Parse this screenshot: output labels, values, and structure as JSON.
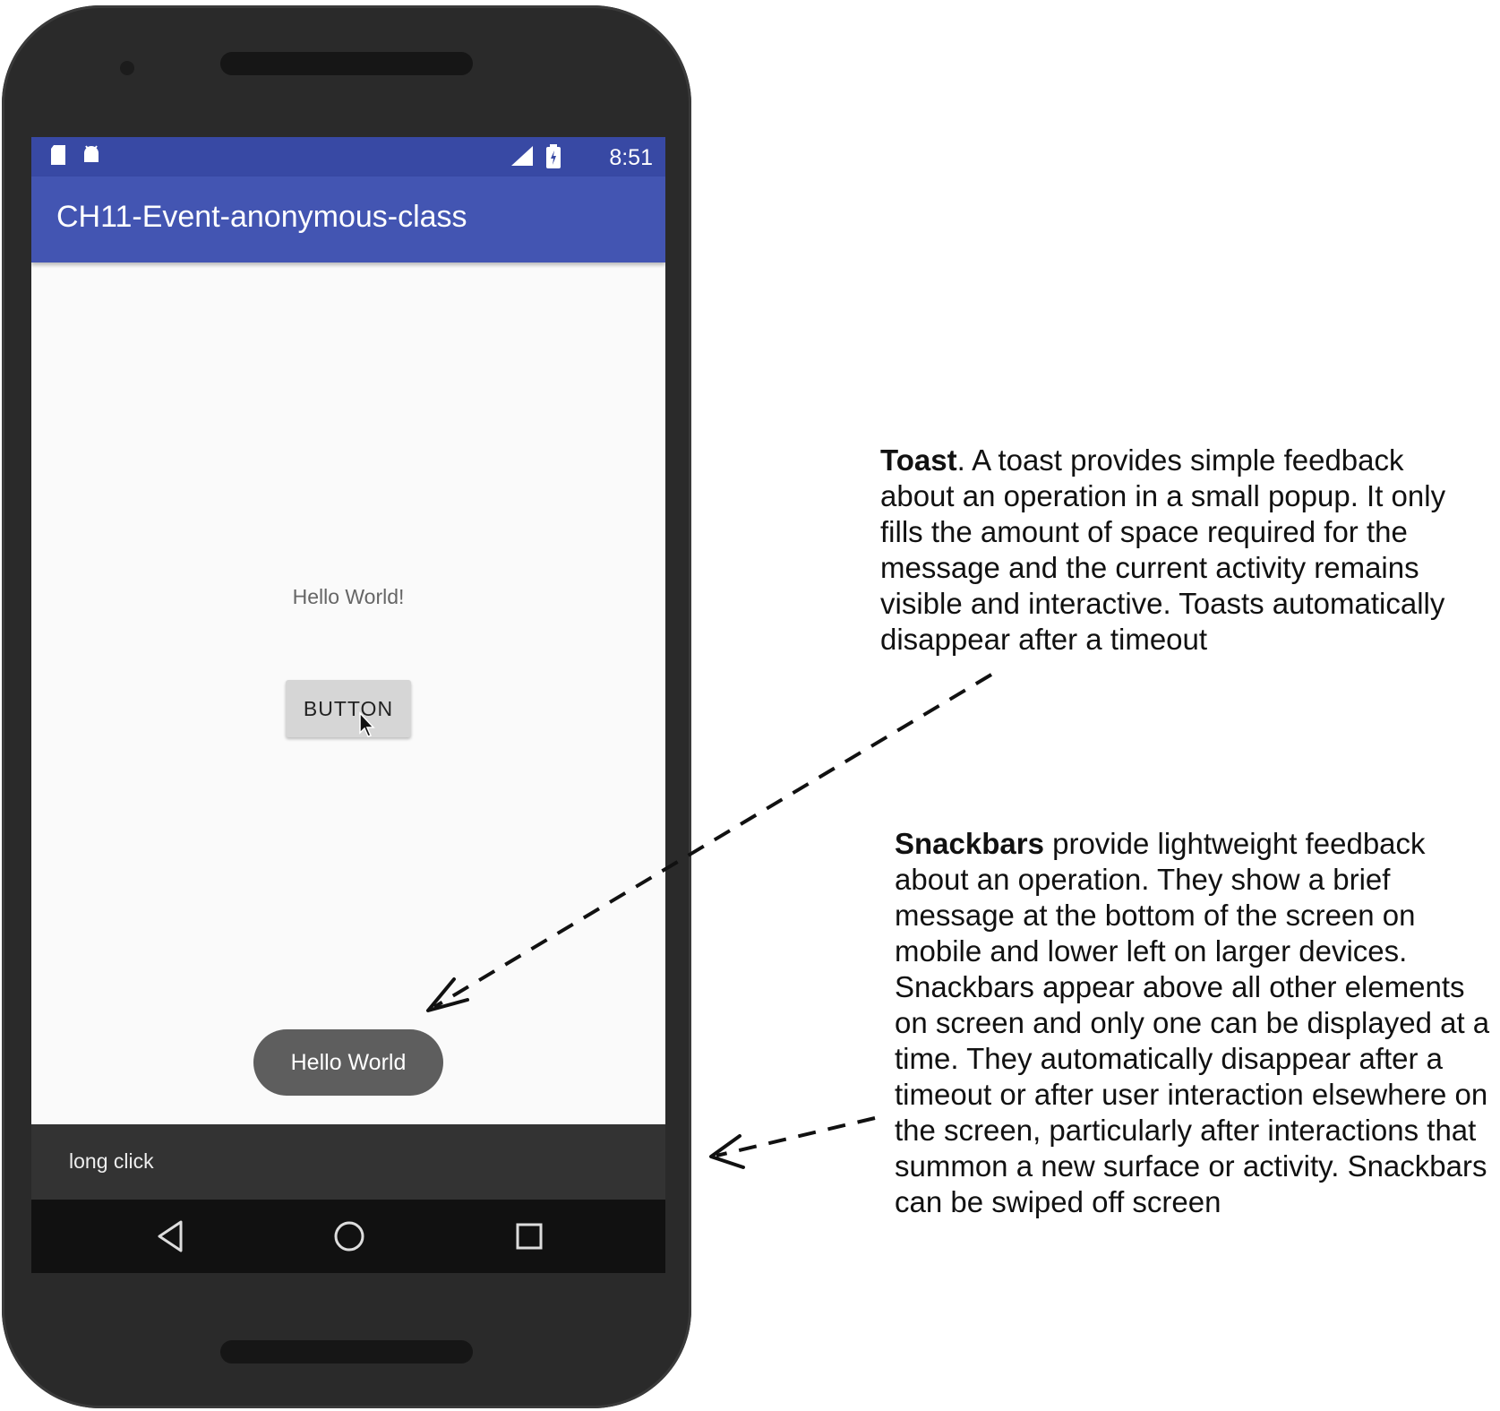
{
  "status_bar": {
    "time": "8:51"
  },
  "app_bar": {
    "title": "CH11-Event-anonymous-class"
  },
  "content": {
    "hello_text": "Hello World!",
    "button_label": "BUTTON",
    "toast_text": "Hello World",
    "snackbar_text": "long click"
  },
  "nav_bar": {
    "back_icon": "back-triangle-icon",
    "home_icon": "home-circle-icon",
    "recents_icon": "recents-square-icon"
  },
  "annotations": {
    "toast": {
      "title": "Toast",
      "body": ". A toast provides simple feedback about an operation in a small popup. It only fills the amount of space required for the message and the current activity remains visible and interactive. Toasts automatically disappear after a timeout"
    },
    "snackbar": {
      "title": "Snackbars",
      "body": "  provide lightweight feedback about an operation. They show a brief message at the bottom of the screen on mobile and lower left on larger devices. Snackbars appear above all other elements on screen and only one can be displayed at a time. They automatically disappear after a timeout or after user interaction elsewhere on the screen, particularly after interactions that summon a new surface or activity. Snackbars can be swiped off screen"
    }
  },
  "colors": {
    "status_bar": "#3849a4",
    "app_bar": "#4355b2",
    "toast_bg": "#5e5e5e",
    "snackbar_bg": "#333333",
    "nav_bar_bg": "#111111"
  }
}
